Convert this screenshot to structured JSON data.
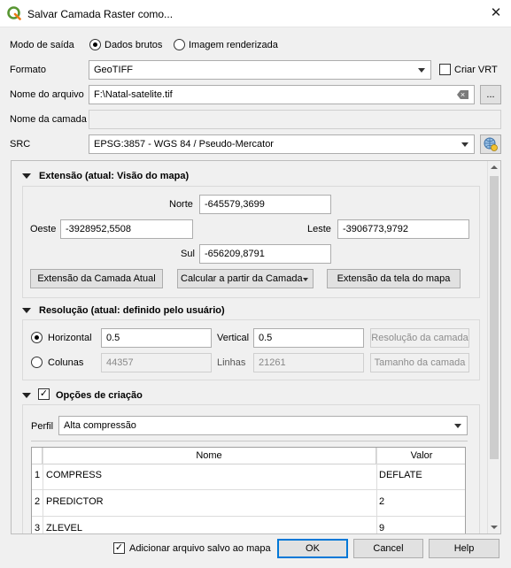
{
  "window": {
    "title": "Salvar Camada Raster como..."
  },
  "modo_saida": {
    "label": "Modo de saída",
    "opt_raw": "Dados brutos",
    "opt_rendered": "Imagem renderizada",
    "selected": "Dados brutos"
  },
  "formato": {
    "label": "Formato",
    "value": "GeoTIFF",
    "criar_vrt_label": "Criar VRT",
    "criar_vrt_checked": false
  },
  "arquivo": {
    "label": "Nome do arquivo",
    "value": "F:\\Natal-satelite.tif",
    "browse_label": "..."
  },
  "camada": {
    "label": "Nome da camada",
    "value": ""
  },
  "src": {
    "label": "SRC",
    "value": "EPSG:3857 - WGS 84 / Pseudo-Mercator"
  },
  "extensao": {
    "title": "Extensão (atual: Visão do mapa)",
    "norte_label": "Norte",
    "norte": "-645579,3699",
    "oeste_label": "Oeste",
    "oeste": "-3928952,5508",
    "leste_label": "Leste",
    "leste": "-3906773,9792",
    "sul_label": "Sul",
    "sul": "-656209,8791",
    "btn_camada_atual": "Extensão da Camada Atual",
    "btn_calcular": "Calcular a partir da Camada",
    "btn_tela": "Extensão da tela do mapa"
  },
  "resolucao": {
    "title": "Resolução (atual: definido pelo usuário)",
    "horizontal_label": "Horizontal",
    "horizontal": "0.5",
    "vertical_label": "Vertical",
    "vertical": "0.5",
    "btn_resolucao": "Resolução da camada",
    "colunas_label": "Colunas",
    "colunas": "44357",
    "linhas_label": "Linhas",
    "linhas": "21261",
    "btn_tamanho": "Tamanho da camada",
    "selected": "Horizontal"
  },
  "opcoes": {
    "title": "Opções de criação",
    "checked": true,
    "perfil_label": "Perfil",
    "perfil": "Alta compressão",
    "table": {
      "headers": [
        "Nome",
        "Valor"
      ],
      "rows": [
        {
          "n": "1",
          "nome": "COMPRESS",
          "valor": "DEFLATE"
        },
        {
          "n": "2",
          "nome": "PREDICTOR",
          "valor": "2"
        },
        {
          "n": "3",
          "nome": "ZLEVEL",
          "valor": "9"
        }
      ]
    }
  },
  "footer": {
    "add_label": "Adicionar arquivo salvo ao mapa",
    "add_checked": true,
    "ok": "OK",
    "cancel": "Cancel",
    "help": "Help"
  },
  "icons": {
    "app": "qgis-logo-icon",
    "close": "close-icon",
    "clear": "clear-text-icon",
    "crs": "crs-selector-icon"
  },
  "colors": {
    "qgis_green": "#589632",
    "primary_border": "#0078d7"
  }
}
